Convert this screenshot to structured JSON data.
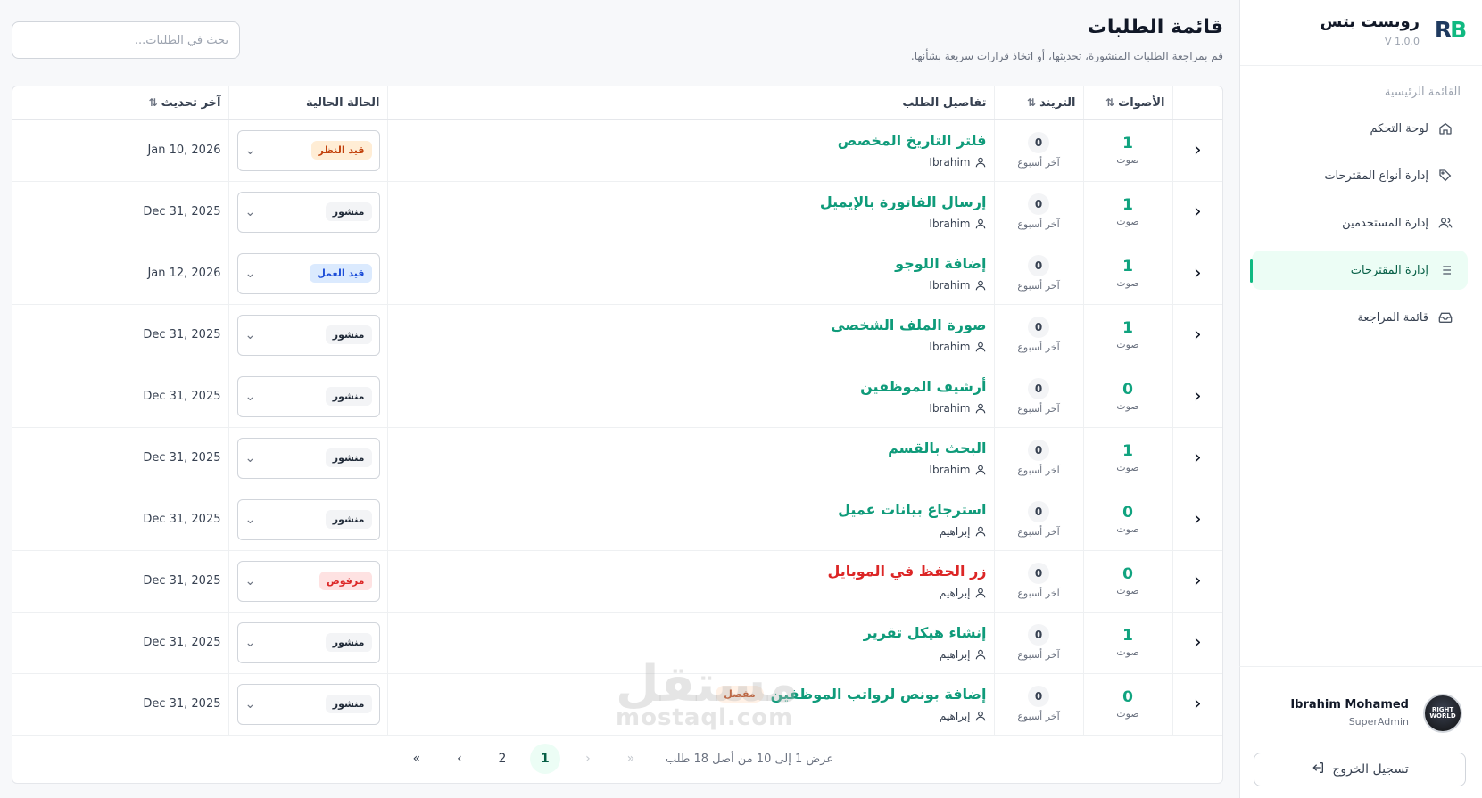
{
  "sidebar": {
    "brand_name": "روبست بتس",
    "brand_version": "V 1.0.0",
    "logo_text": "RB",
    "section_title": "القائمة الرئيسية",
    "items": [
      {
        "label": "لوحة التحكم",
        "icon": "home-icon"
      },
      {
        "label": "إدارة أنواع المقترحات",
        "icon": "tag-icon"
      },
      {
        "label": "إدارة المستخدمين",
        "icon": "users-icon"
      },
      {
        "label": "إدارة المقترحات",
        "icon": "list-icon",
        "active": true
      },
      {
        "label": "قائمة المراجعة",
        "icon": "inbox-icon"
      }
    ],
    "user": {
      "name": "Ibrahim Mohamed",
      "role": "SuperAdmin",
      "avatar_text": "RIGHT WORLD"
    },
    "logout_label": "تسجيل الخروج"
  },
  "header": {
    "title": "قائمة الطلبات",
    "subtitle": "قم بمراجعة الطلبات المنشورة، تحديثها، أو اتخاذ قرارات سريعة بشأنها.",
    "search_placeholder": "بحث في الطلبات..."
  },
  "table": {
    "columns": {
      "votes": "الأصوات",
      "trend": "التريند",
      "details": "تفاصيل الطلب",
      "status": "الحالة الحالية",
      "updated": "آخر تحديث"
    },
    "vote_unit": "صوت",
    "trend_unit": "آخر أسبوع",
    "rows": [
      {
        "votes": "1",
        "trend": "0",
        "title": "فلتر التاريخ المخصص",
        "author": "Ibrahim",
        "status": "قيد النظر",
        "status_type": "pending",
        "date": "Jan 10, 2026"
      },
      {
        "votes": "1",
        "trend": "0",
        "title": "إرسال الفاتورة بالإيميل",
        "author": "Ibrahim",
        "status": "منشور",
        "status_type": "published",
        "date": "Dec 31, 2025"
      },
      {
        "votes": "1",
        "trend": "0",
        "title": "إضافة اللوجو",
        "author": "Ibrahim",
        "status": "قيد العمل",
        "status_type": "progress",
        "date": "Jan 12, 2026"
      },
      {
        "votes": "1",
        "trend": "0",
        "title": "صورة الملف الشخصي",
        "author": "Ibrahim",
        "status": "منشور",
        "status_type": "published",
        "date": "Dec 31, 2025"
      },
      {
        "votes": "0",
        "trend": "0",
        "title": "أرشيف الموظفين",
        "author": "Ibrahim",
        "status": "منشور",
        "status_type": "published",
        "date": "Dec 31, 2025"
      },
      {
        "votes": "1",
        "trend": "0",
        "title": "البحث بالقسم",
        "author": "Ibrahim",
        "status": "منشور",
        "status_type": "published",
        "date": "Dec 31, 2025"
      },
      {
        "votes": "0",
        "trend": "0",
        "title": "استرجاع بيانات عميل",
        "author": "إبراهيم",
        "status": "منشور",
        "status_type": "published",
        "date": "Dec 31, 2025"
      },
      {
        "votes": "0",
        "trend": "0",
        "title": "زر الحفظ في الموبايل",
        "author": "إبراهيم",
        "status": "مرفوض",
        "status_type": "rejected",
        "date": "Dec 31, 2025",
        "title_color": "red"
      },
      {
        "votes": "1",
        "trend": "0",
        "title": "إنشاء هيكل تقرير",
        "author": "إبراهيم",
        "status": "منشور",
        "status_type": "published",
        "date": "Dec 31, 2025"
      },
      {
        "votes": "0",
        "trend": "0",
        "title": "إضافة بونص لرواتب الموظفين",
        "author": "إبراهيم",
        "status": "منشور",
        "status_type": "published",
        "date": "Dec 31, 2025",
        "tag": "مفصل"
      }
    ]
  },
  "pagination": {
    "info": "عرض 1 إلى 10 من أصل 18 طلب",
    "pages": [
      "1",
      "2"
    ],
    "current": "1",
    "first": "«",
    "prev": "‹",
    "next": "›",
    "last": "»"
  },
  "watermark": {
    "ar": "مستقل",
    "en": "mostaql.com"
  }
}
